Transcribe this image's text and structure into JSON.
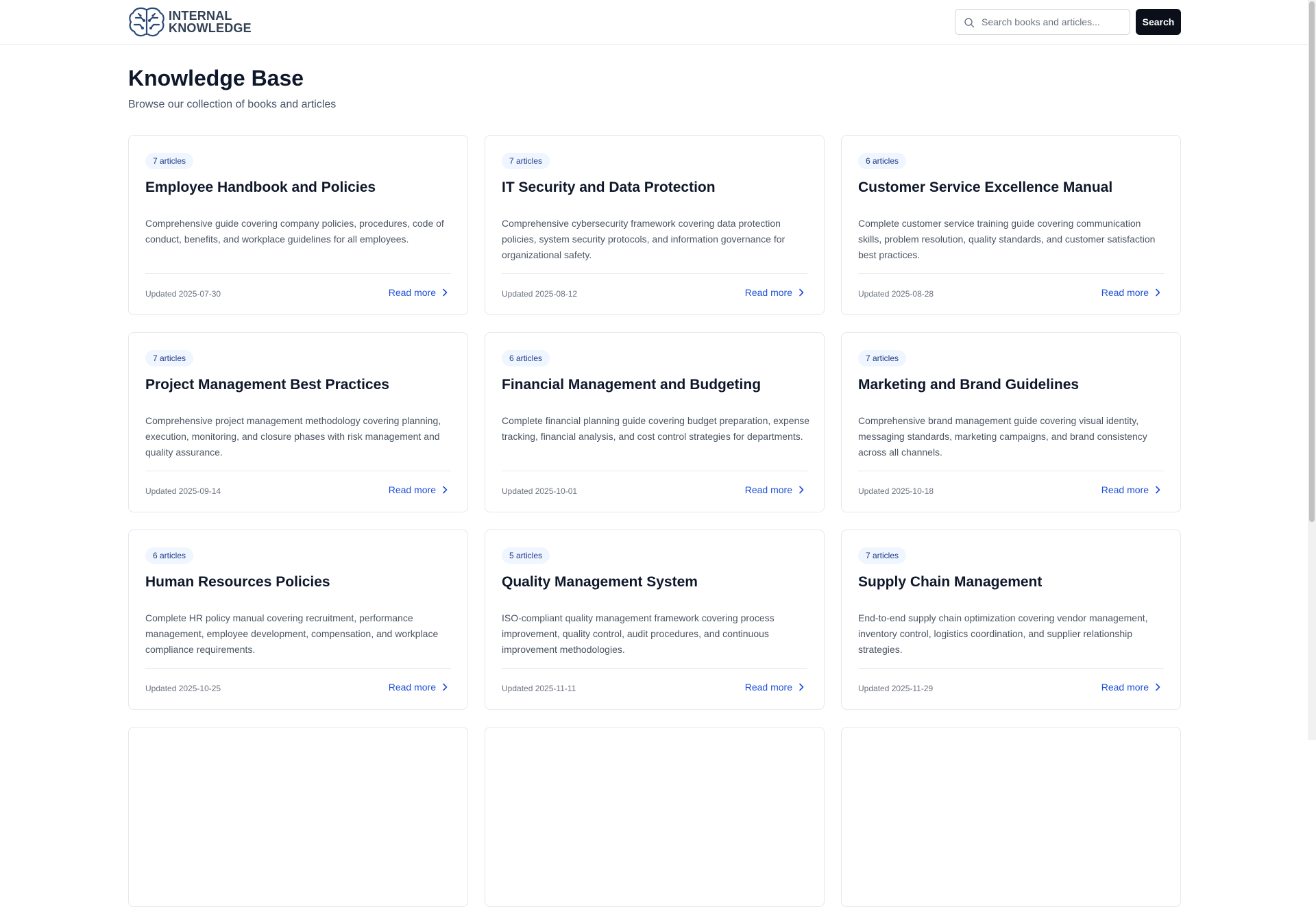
{
  "header": {
    "logo_line1": "INTERNAL",
    "logo_line2": "KNOWLEDGE",
    "search_placeholder": "Search books and articles...",
    "search_value": "",
    "search_button": "Search",
    "icons": {
      "logo": "brain-circuit-icon",
      "search": "search-icon"
    }
  },
  "page": {
    "title": "Knowledge Base",
    "subtitle": "Browse our collection of books and articles"
  },
  "books": [
    {
      "badge": "7 articles",
      "title": "Employee Handbook and Policies",
      "description": "Comprehensive guide covering company policies, procedures, code of conduct, benefits, and workplace guidelines for all employees.",
      "updated": "Updated 2025-07-30",
      "link": "Read more"
    },
    {
      "badge": "7 articles",
      "title": "IT Security and Data Protection",
      "description": "Comprehensive cybersecurity framework covering data protection policies, system security protocols, and information governance for organizational safety.",
      "updated": "Updated 2025-08-12",
      "link": "Read more"
    },
    {
      "badge": "6 articles",
      "title": "Customer Service Excellence Manual",
      "description": "Complete customer service training guide covering communication skills, problem resolution, quality standards, and customer satisfaction best practices.",
      "updated": "Updated 2025-08-28",
      "link": "Read more"
    },
    {
      "badge": "7 articles",
      "title": "Project Management Best Practices",
      "description": "Comprehensive project management methodology covering planning, execution, monitoring, and closure phases with risk management and quality assurance.",
      "updated": "Updated 2025-09-14",
      "link": "Read more"
    },
    {
      "badge": "6 articles",
      "title": "Financial Management and Budgeting",
      "description": "Complete financial planning guide covering budget preparation, expense tracking, financial analysis, and cost control strategies for departments.",
      "updated": "Updated 2025-10-01",
      "link": "Read more"
    },
    {
      "badge": "7 articles",
      "title": "Marketing and Brand Guidelines",
      "description": "Comprehensive brand management guide covering visual identity, messaging standards, marketing campaigns, and brand consistency across all channels.",
      "updated": "Updated 2025-10-18",
      "link": "Read more"
    },
    {
      "badge": "6 articles",
      "title": "Human Resources Policies",
      "description": "Complete HR policy manual covering recruitment, performance management, employee development, compensation, and workplace compliance requirements.",
      "updated": "Updated 2025-10-25",
      "link": "Read more"
    },
    {
      "badge": "5 articles",
      "title": "Quality Management System",
      "description": "ISO-compliant quality management framework covering process improvement, quality control, audit procedures, and continuous improvement methodologies.",
      "updated": "Updated 2025-11-11",
      "link": "Read more"
    },
    {
      "badge": "7 articles",
      "title": "Supply Chain Management",
      "description": "End-to-end supply chain optimization covering vendor management, inventory control, logistics coordination, and supplier relationship strategies.",
      "updated": "Updated 2025-11-29",
      "link": "Read more"
    }
  ],
  "colors": {
    "accent": "#1d4ed8",
    "badge_bg": "#eff6ff",
    "button_bg": "#0b0f19"
  }
}
